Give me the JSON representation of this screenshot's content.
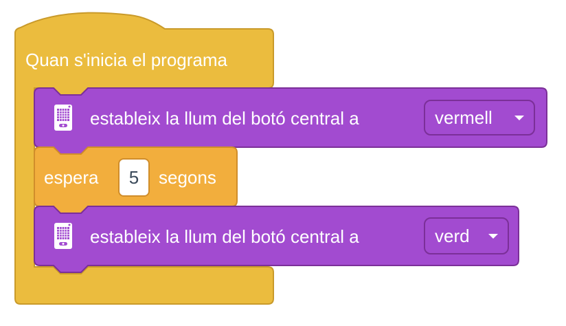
{
  "colors": {
    "events": "#ebbc3e",
    "events_border": "#c99a2a",
    "light": "#a24bd0",
    "light_border": "#7b2f98",
    "control": "#f2ae3d",
    "control_border": "#d08d2a"
  },
  "hat_block": {
    "label": "Quan s'inicia el programa"
  },
  "blocks": [
    {
      "icon": "hub-icon",
      "label": "estableix la llum del botó central a",
      "dropdown_value": "vermell"
    },
    {
      "label_before": "espera",
      "value": "5",
      "label_after": "segons"
    },
    {
      "icon": "hub-icon",
      "label": "estableix la llum del botó central a",
      "dropdown_value": "verd"
    }
  ]
}
